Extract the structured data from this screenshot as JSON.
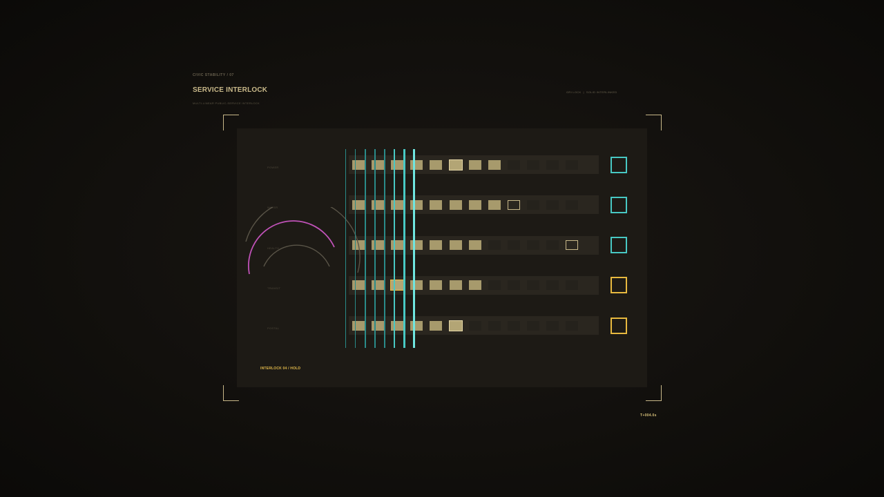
{
  "header": {
    "eyebrow": "CIVIC STABILITY / 07",
    "title": "SERVICE INTERLOCK",
    "subtitle": "MULTI-LINEAR PUBLIC-SERVICE INTERLOCK",
    "meta_left": "GRI LOCK",
    "meta_right": "SOLID INTERLINKED"
  },
  "rows": [
    {
      "label": "POWER",
      "lit": 8,
      "cursor_index": 5,
      "cursor_style": "cur",
      "status": "ok"
    },
    {
      "label": "WATER",
      "lit": 8,
      "cursor_index": 8,
      "cursor_style": "curoff",
      "status": "ok"
    },
    {
      "label": "HEALTH",
      "lit": 7,
      "cursor_index": 11,
      "cursor_style": "curoff",
      "status": "ok"
    },
    {
      "label": "TRANSIT",
      "lit": 7,
      "cursor_index": 2,
      "cursor_style": "curwarn",
      "status": "warn"
    },
    {
      "label": "POSTAL",
      "lit": 6,
      "cursor_index": 5,
      "cursor_style": "cur",
      "status": "warn"
    }
  ],
  "cells_per_row": 12,
  "status_text": "INTERLOCK 04 / HOLD",
  "timer": "T+004.0s",
  "colors": {
    "accent": "#c9b98a",
    "ok": "#48c9c4",
    "warn": "#e8b93f",
    "arc": "#c052b8"
  }
}
